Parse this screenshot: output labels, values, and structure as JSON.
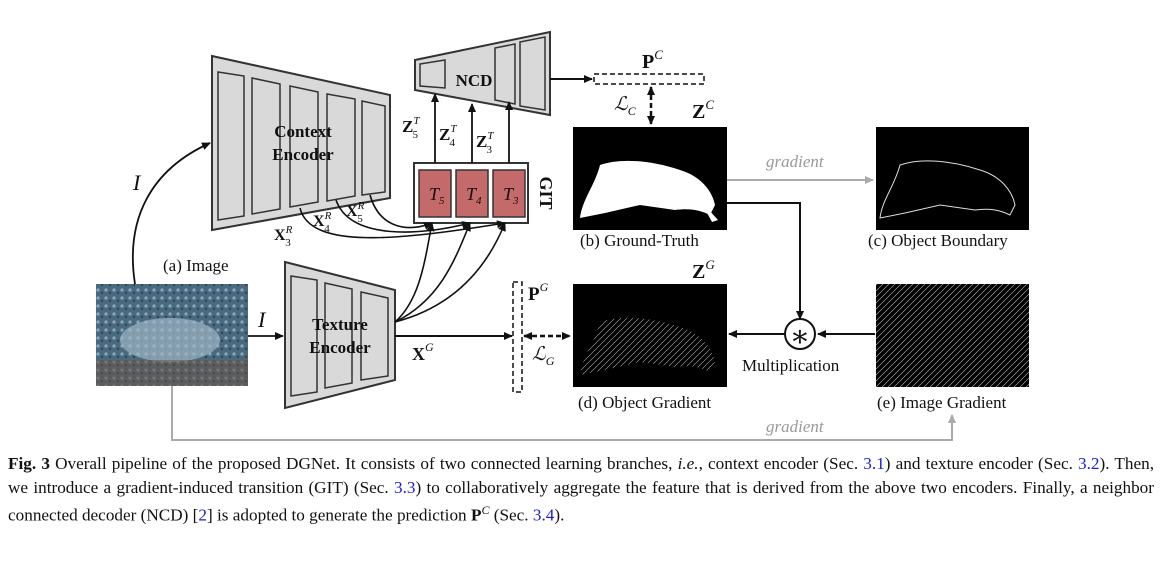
{
  "figure": {
    "encoders": {
      "context": {
        "line1": "Context",
        "line2": "Encoder"
      },
      "texture": {
        "line1": "Texture",
        "line2": "Encoder"
      },
      "ncd": "NCD",
      "git": "GIT",
      "git_blocks": [
        "T",
        "T",
        "T"
      ],
      "git_subs": [
        "5",
        "4",
        "3"
      ]
    },
    "math": {
      "I": "I",
      "Z": "Z",
      "X": "X",
      "P": "P",
      "L": "L",
      "sup_T": "T",
      "sup_R": "R",
      "sup_C": "C",
      "sup_G": "G",
      "sub_C": "C",
      "sub_G": "G",
      "s5": "5",
      "s4": "4",
      "s3": "3"
    },
    "panels": {
      "a": "(a) Image",
      "b": "(b) Ground-Truth",
      "c": "(c) Object Boundary",
      "d": "(d) Object Gradient",
      "e": "(e) Image Gradient"
    },
    "labels": {
      "gradient_top": "gradient",
      "gradient_bottom": "gradient",
      "multiplication": "Multiplication",
      "multiply_symbol": "∗"
    },
    "colors": {
      "encoder_fill": "#d9d9d9",
      "encoder_stroke": "#444444",
      "git_block": "#c46a6a",
      "gray_arrow": "#aaaaaa",
      "link_blue": "#1a1ad6"
    }
  },
  "caption": {
    "fig_label": "Fig. 3",
    "part1": " Overall pipeline of the proposed DGNet. It consists of two connected learning branches, ",
    "ie": "i.e.",
    "part2": ", context encoder (Sec. ",
    "ref1": "3.1",
    "part3": ") and texture encoder (Sec. ",
    "ref2": "3.2",
    "part4": "). Then, we introduce a gradient-induced transition (GIT) (Sec. ",
    "ref3": "3.3",
    "part5": ") to collaboratively aggregate the feature that is derived from the above two encoders. Finally, a neighbor connected decoder (NCD) [",
    "ref4": "2",
    "part6": "] is adopted to generate the prediction ",
    "pc": "P",
    "pc_sup": "C",
    "part7": " (Sec. ",
    "ref5": "3.4",
    "part8": ")."
  }
}
